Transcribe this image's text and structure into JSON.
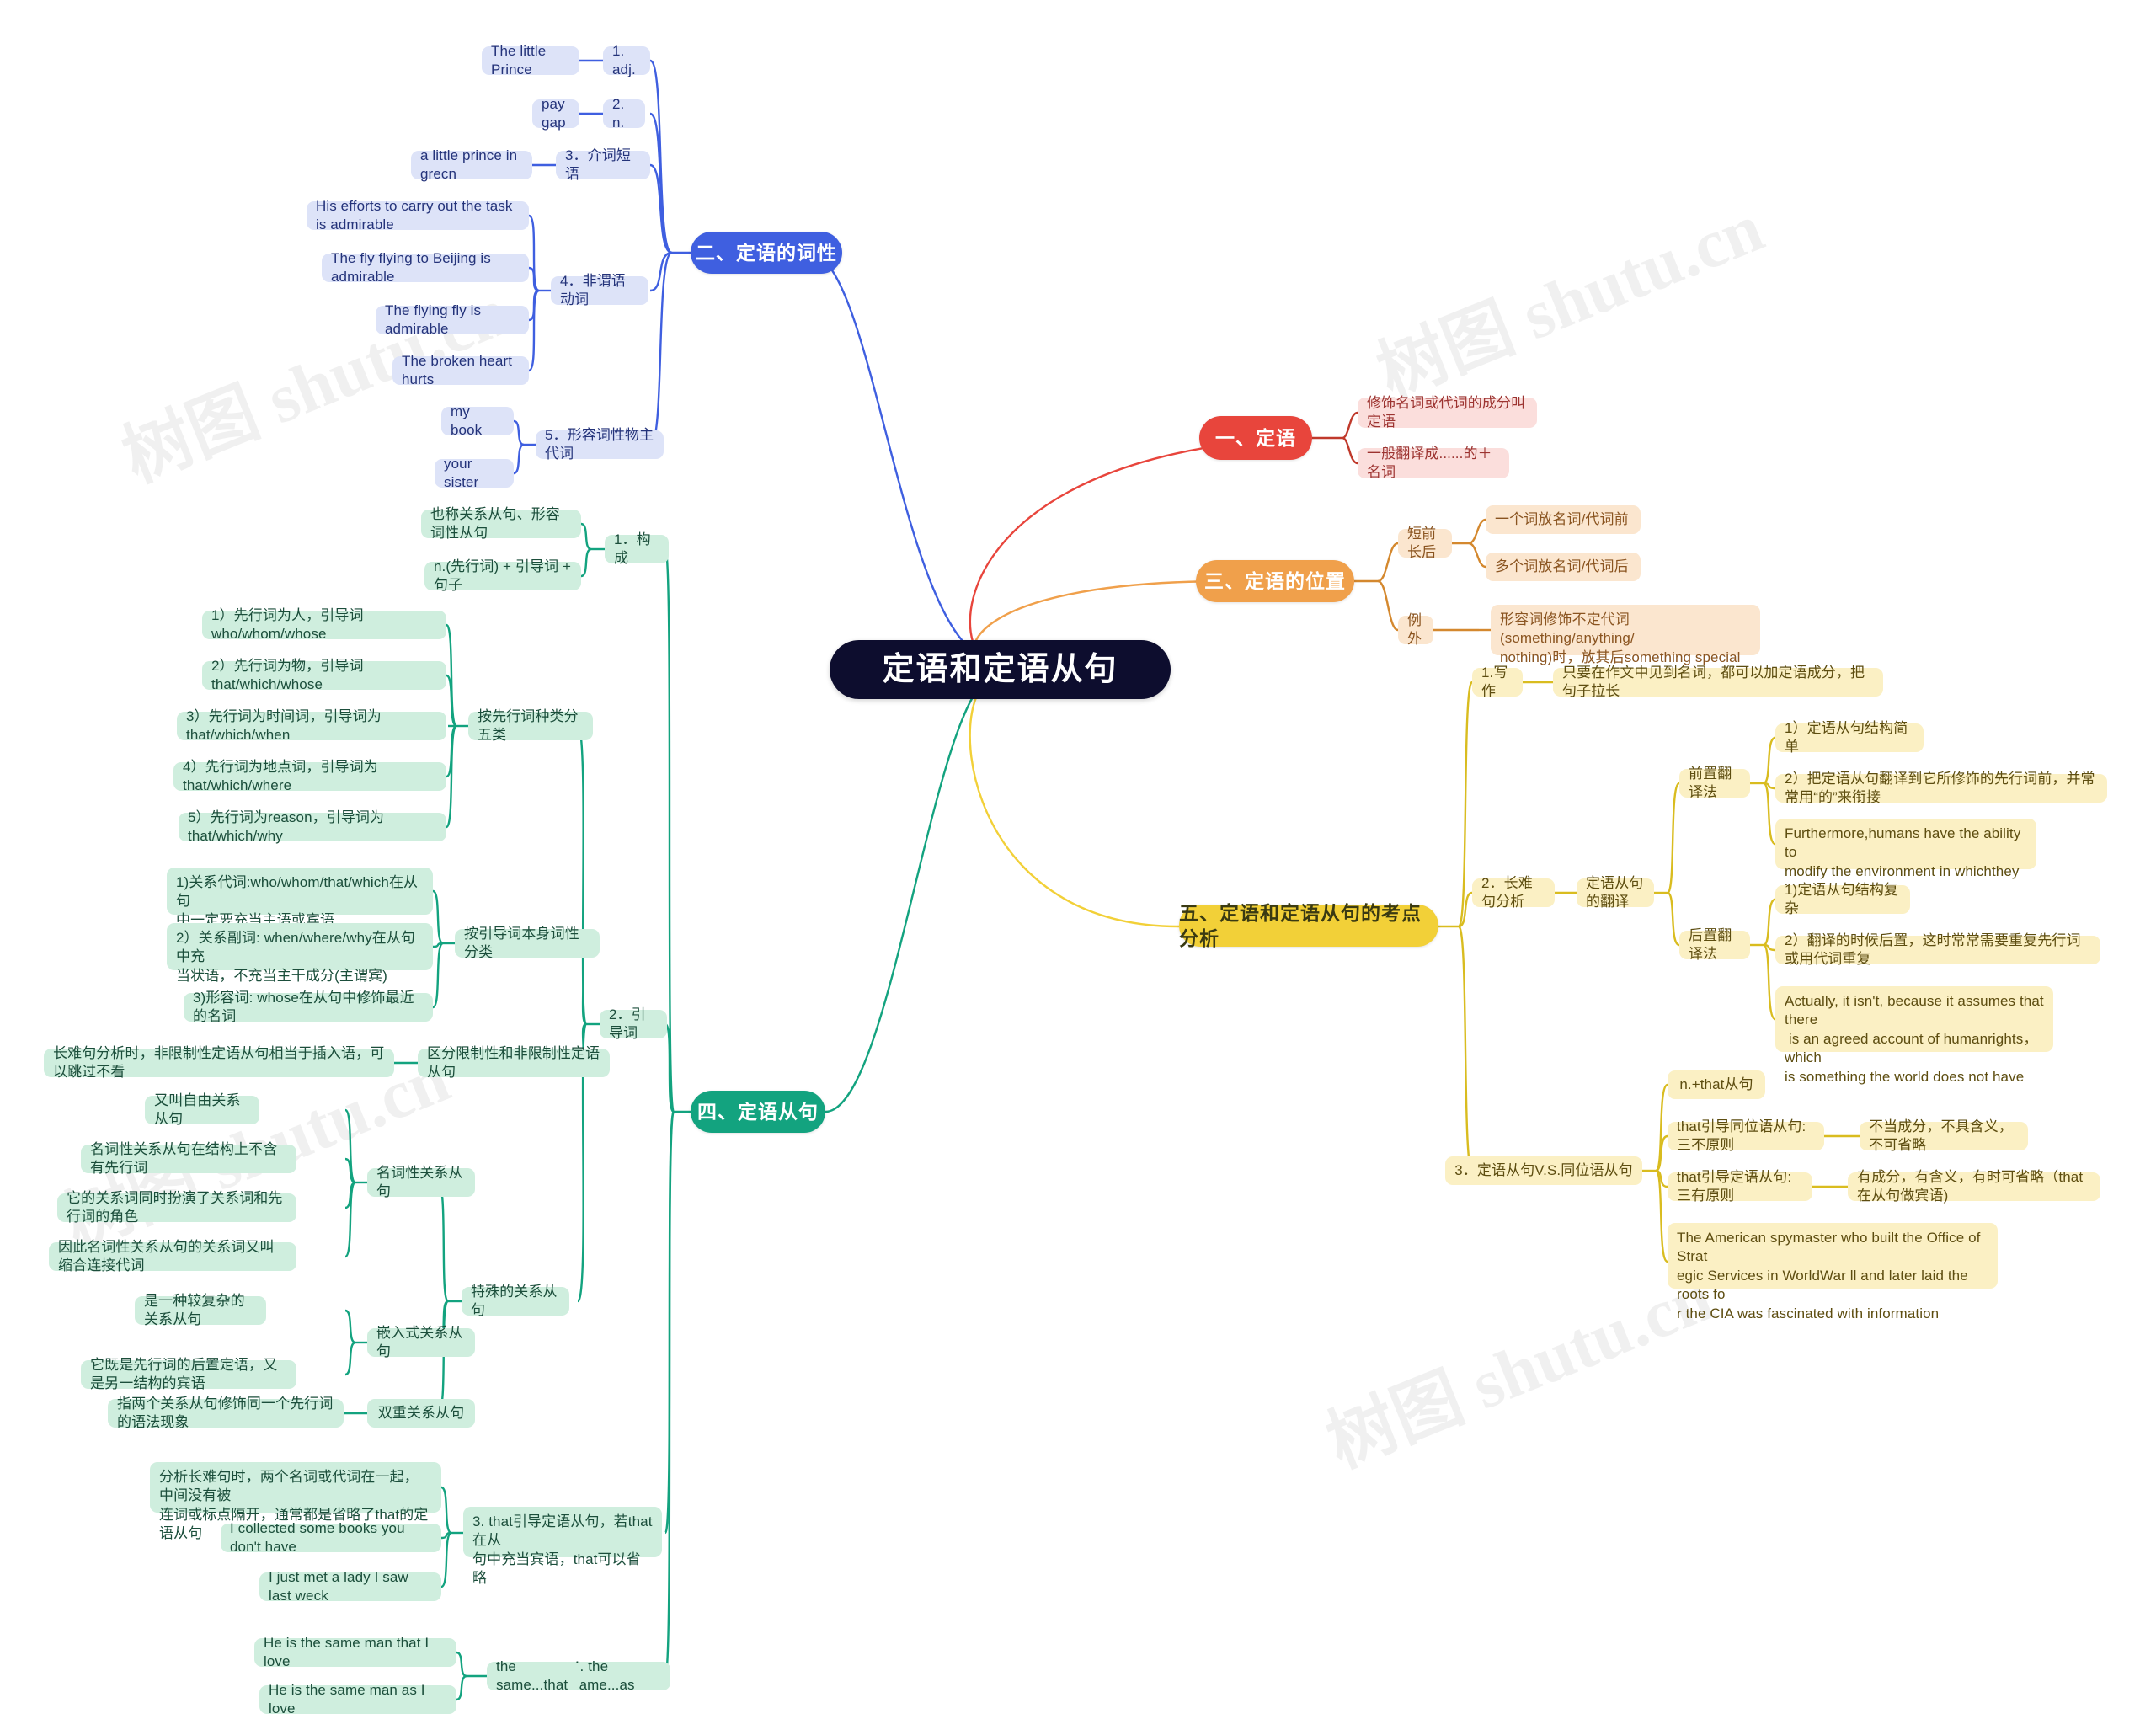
{
  "root": {
    "label": "定语和定语从句"
  },
  "watermark": {
    "text": "树图 shutu.cn"
  },
  "colors": {
    "root_bg": "#0d0d2e",
    "red": "#e8453c",
    "blue": "#3f5fe0",
    "orange": "#f0a04b",
    "green": "#13a37f",
    "yellow": "#f2d038"
  },
  "branches": {
    "ding_yu": {
      "label": "一、定语",
      "children": [
        {
          "label": "修饰名词或代词的成分叫定语"
        },
        {
          "label": "一般翻译成......的＋名词"
        }
      ]
    },
    "ci_xing": {
      "label": "二、定语的词性",
      "children": [
        {
          "label": "1. adj.",
          "examples": [
            "The little Prince"
          ]
        },
        {
          "label": "2. n.",
          "examples": [
            "pay gap"
          ]
        },
        {
          "label": "3．介词短语",
          "examples": [
            "a little prince in grecn"
          ]
        },
        {
          "label": "4．非谓语动词",
          "examples": [
            "His efforts to carry out the task is admirable",
            "The fly flying to Beijing is admirable",
            "The flying fly is admirable",
            "The broken heart hurts"
          ]
        },
        {
          "label": "5．形容词性物主代词",
          "examples": [
            "my book",
            "your sister"
          ]
        }
      ]
    },
    "wei_zhi": {
      "label": "三、定语的位置",
      "children": [
        {
          "label": "短前长后",
          "examples": [
            "一个词放名词/代词前",
            "多个词放名词/代词后"
          ]
        },
        {
          "label": "例外",
          "examples": [
            "形容词修饰不定代词(something/anything/\nnothing)时，放其后something special"
          ]
        }
      ]
    },
    "cong_ju": {
      "label": "四、定语从句",
      "children": [
        {
          "label": "1．构成",
          "examples": [
            "也称关系从句、形容词性从句",
            "n.(先行词) + 引导词 + 句子"
          ]
        },
        {
          "label": "2．引导词",
          "groups": [
            {
              "label": "按先行词种类分五类",
              "items": [
                "1）先行词为人，引导词who/whom/whose",
                "2）先行词为物，引导词 that/which/whose",
                "3）先行词为时间词，引导词为that/which/when",
                "4）先行词为地点词，引导词为that/which/where",
                "5）先行词为reason，引导词为that/which/why"
              ]
            },
            {
              "label": "按引导词本身词性分类",
              "items": [
                "1)关系代词:who/whom/that/which在从句\n中一定要充当主语或宾语",
                "2）关系副词: when/where/why在从句中充\n当状语，不充当主干成分(主谓宾)",
                "3)形容词: whose在从句中修饰最近的名词"
              ]
            },
            {
              "label": "区分限制性和非限制性定语从句",
              "items": [
                "长难句分析时，非限制性定语从句相当于插入语，可以跳过不看"
              ]
            },
            {
              "label": "特殊的关系从句",
              "subgroups": [
                {
                  "label": "名词性关系从句",
                  "items": [
                    "又叫自由关系从句",
                    "名词性关系从句在结构上不含有先行词",
                    "它的关系词同时扮演了关系词和先行词的角色",
                    "因此名词性关系从句的关系词又叫缩合连接代词"
                  ]
                },
                {
                  "label": "嵌入式关系从句",
                  "items": [
                    "是一种较复杂的关系从句",
                    "它既是先行词的后置定语，又是另一结构的宾语"
                  ]
                },
                {
                  "label": "双重关系从句",
                  "items": [
                    "指两个关系从句修饰同一个先行词的语法现象"
                  ]
                }
              ]
            }
          ]
        },
        {
          "label": "3. that引导定语从句，若that在从\n句中充当宾语，that可以省略",
          "examples": [
            "分析长难句时，两个名词或代词在一起，中间没有被\n连词或标点隔开，通常都是省略了that的定语从句",
            "I collected some books you don't have",
            "I just met a lady I saw last weck"
          ]
        },
        {
          "label": "4. the same...as",
          "examples_group": {
            "label": "the same...that",
            "items": [
              "He is the same man that I love",
              "He is the same man as I love"
            ]
          }
        }
      ]
    },
    "kao_dian": {
      "label": "五、定语和定语从句的考点分析",
      "children": [
        {
          "label": "1.写作",
          "examples": [
            "只要在作文中见到名词，都可以加定语成分，把句子拉长"
          ]
        },
        {
          "label": "2．长难句分析",
          "mid": "定语从句的翻译",
          "groups": [
            {
              "label": "前置翻译法",
              "items": [
                "1）定语从句结构简单",
                "2）把定语从句翻译到它所修饰的先行词前，并常常用“的”来衔接",
                "Furthermore,humans have the ability to\nmodify the environment in whichthey live"
              ]
            },
            {
              "label": "后置翻译法",
              "items": [
                "1)定语从句结构复杂",
                "2）翻译的时候后置，这时常常需要重复先行词或用代词重复",
                "Actually, it isn't, because it assumes that there\n is an agreed account of humanrights，which\nis something the world does not have"
              ]
            }
          ]
        },
        {
          "label": "3．定语从句V.S.同位语从句",
          "items": [
            "n.+that从句",
            "that引导同位语从句:三不原则",
            "that引导定语从句:三有原则",
            "The American spymaster who built the Office of Strat\negic Services in WorldWar ll and later laid the roots fo\nr the CIA was fascinated with information"
          ],
          "tails": [
            "不当成分，不具含义，不可省略",
            "有成分，有含义，有时可省略（that在从句做宾语)"
          ]
        }
      ]
    }
  }
}
